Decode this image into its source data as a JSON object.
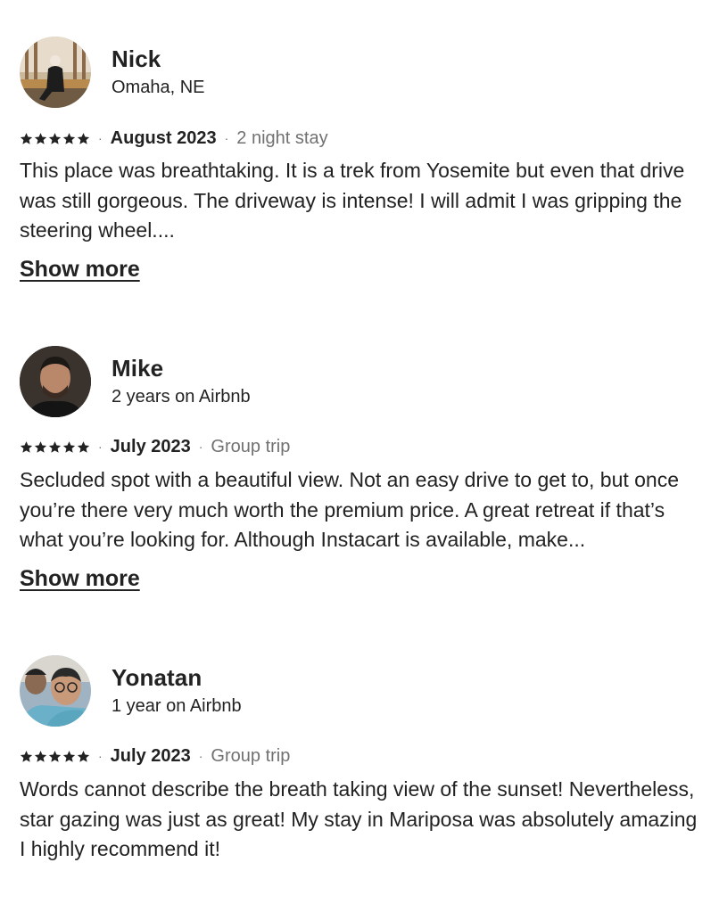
{
  "reviews": [
    {
      "name": "Nick",
      "subtitle": "Omaha, NE",
      "avatar": "profile-photo",
      "rating": 5,
      "date": "August 2023",
      "stay": "2 night stay",
      "text": "This place was breathtaking. It is a trek from Yosemite but even that drive was still gorgeous. The driveway is intense! I will admit I was gripping the steering wheel....",
      "show_more": "Show more"
    },
    {
      "name": "Mike",
      "subtitle": "2 years on Airbnb",
      "avatar": "profile-photo",
      "rating": 5,
      "date": "July 2023",
      "stay": "Group trip",
      "text": "Secluded spot with a beautiful view. Not an easy drive to get to, but once you’re there very much worth the premium price. A great retreat if that’s what you’re looking for. Although Instacart is available, make...",
      "show_more": "Show more"
    },
    {
      "name": "Yonatan",
      "subtitle": "1 year on Airbnb",
      "avatar": "profile-photo",
      "rating": 5,
      "date": "July 2023",
      "stay": "Group trip",
      "text": "Words cannot describe the breath taking view of the sunset! Nevertheless, star gazing was just as great! My stay in Mariposa was absolutely amazing I highly recommend it!"
    }
  ],
  "colors": {
    "text": "#222222",
    "secondary": "#717171"
  }
}
